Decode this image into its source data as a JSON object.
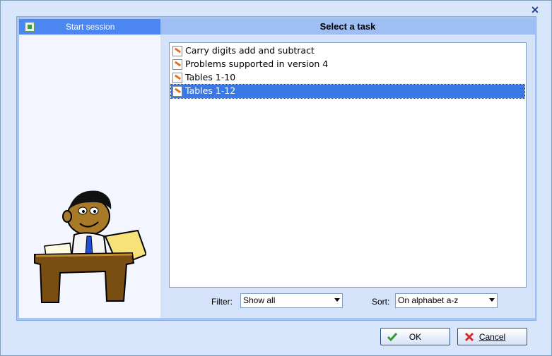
{
  "window": {
    "close_symbol": "✕"
  },
  "left_panel": {
    "header_label": "Start session",
    "icon": "session-icon"
  },
  "right_panel": {
    "title": "Select a task"
  },
  "task_list": {
    "items": [
      {
        "label": "Carry digits add and subtract",
        "icon": "document-pencil-icon",
        "selected": false
      },
      {
        "label": "Problems supported in version 4",
        "icon": "document-pencil-icon",
        "selected": false
      },
      {
        "label": "Tables 1-10",
        "icon": "document-pencil-icon",
        "selected": false
      },
      {
        "label": "Tables 1-12",
        "icon": "document-pencil-icon",
        "selected": true
      }
    ]
  },
  "filter": {
    "label": "Filter:",
    "value": "Show all"
  },
  "sort": {
    "label": "Sort:",
    "value": "On alphabet a-z"
  },
  "buttons": {
    "ok_label": "OK",
    "cancel_label": "Cancel"
  },
  "colors": {
    "header_blue": "#4c86f0",
    "selection": "#3a78e6",
    "panel_bg": "#d4e3fa"
  }
}
